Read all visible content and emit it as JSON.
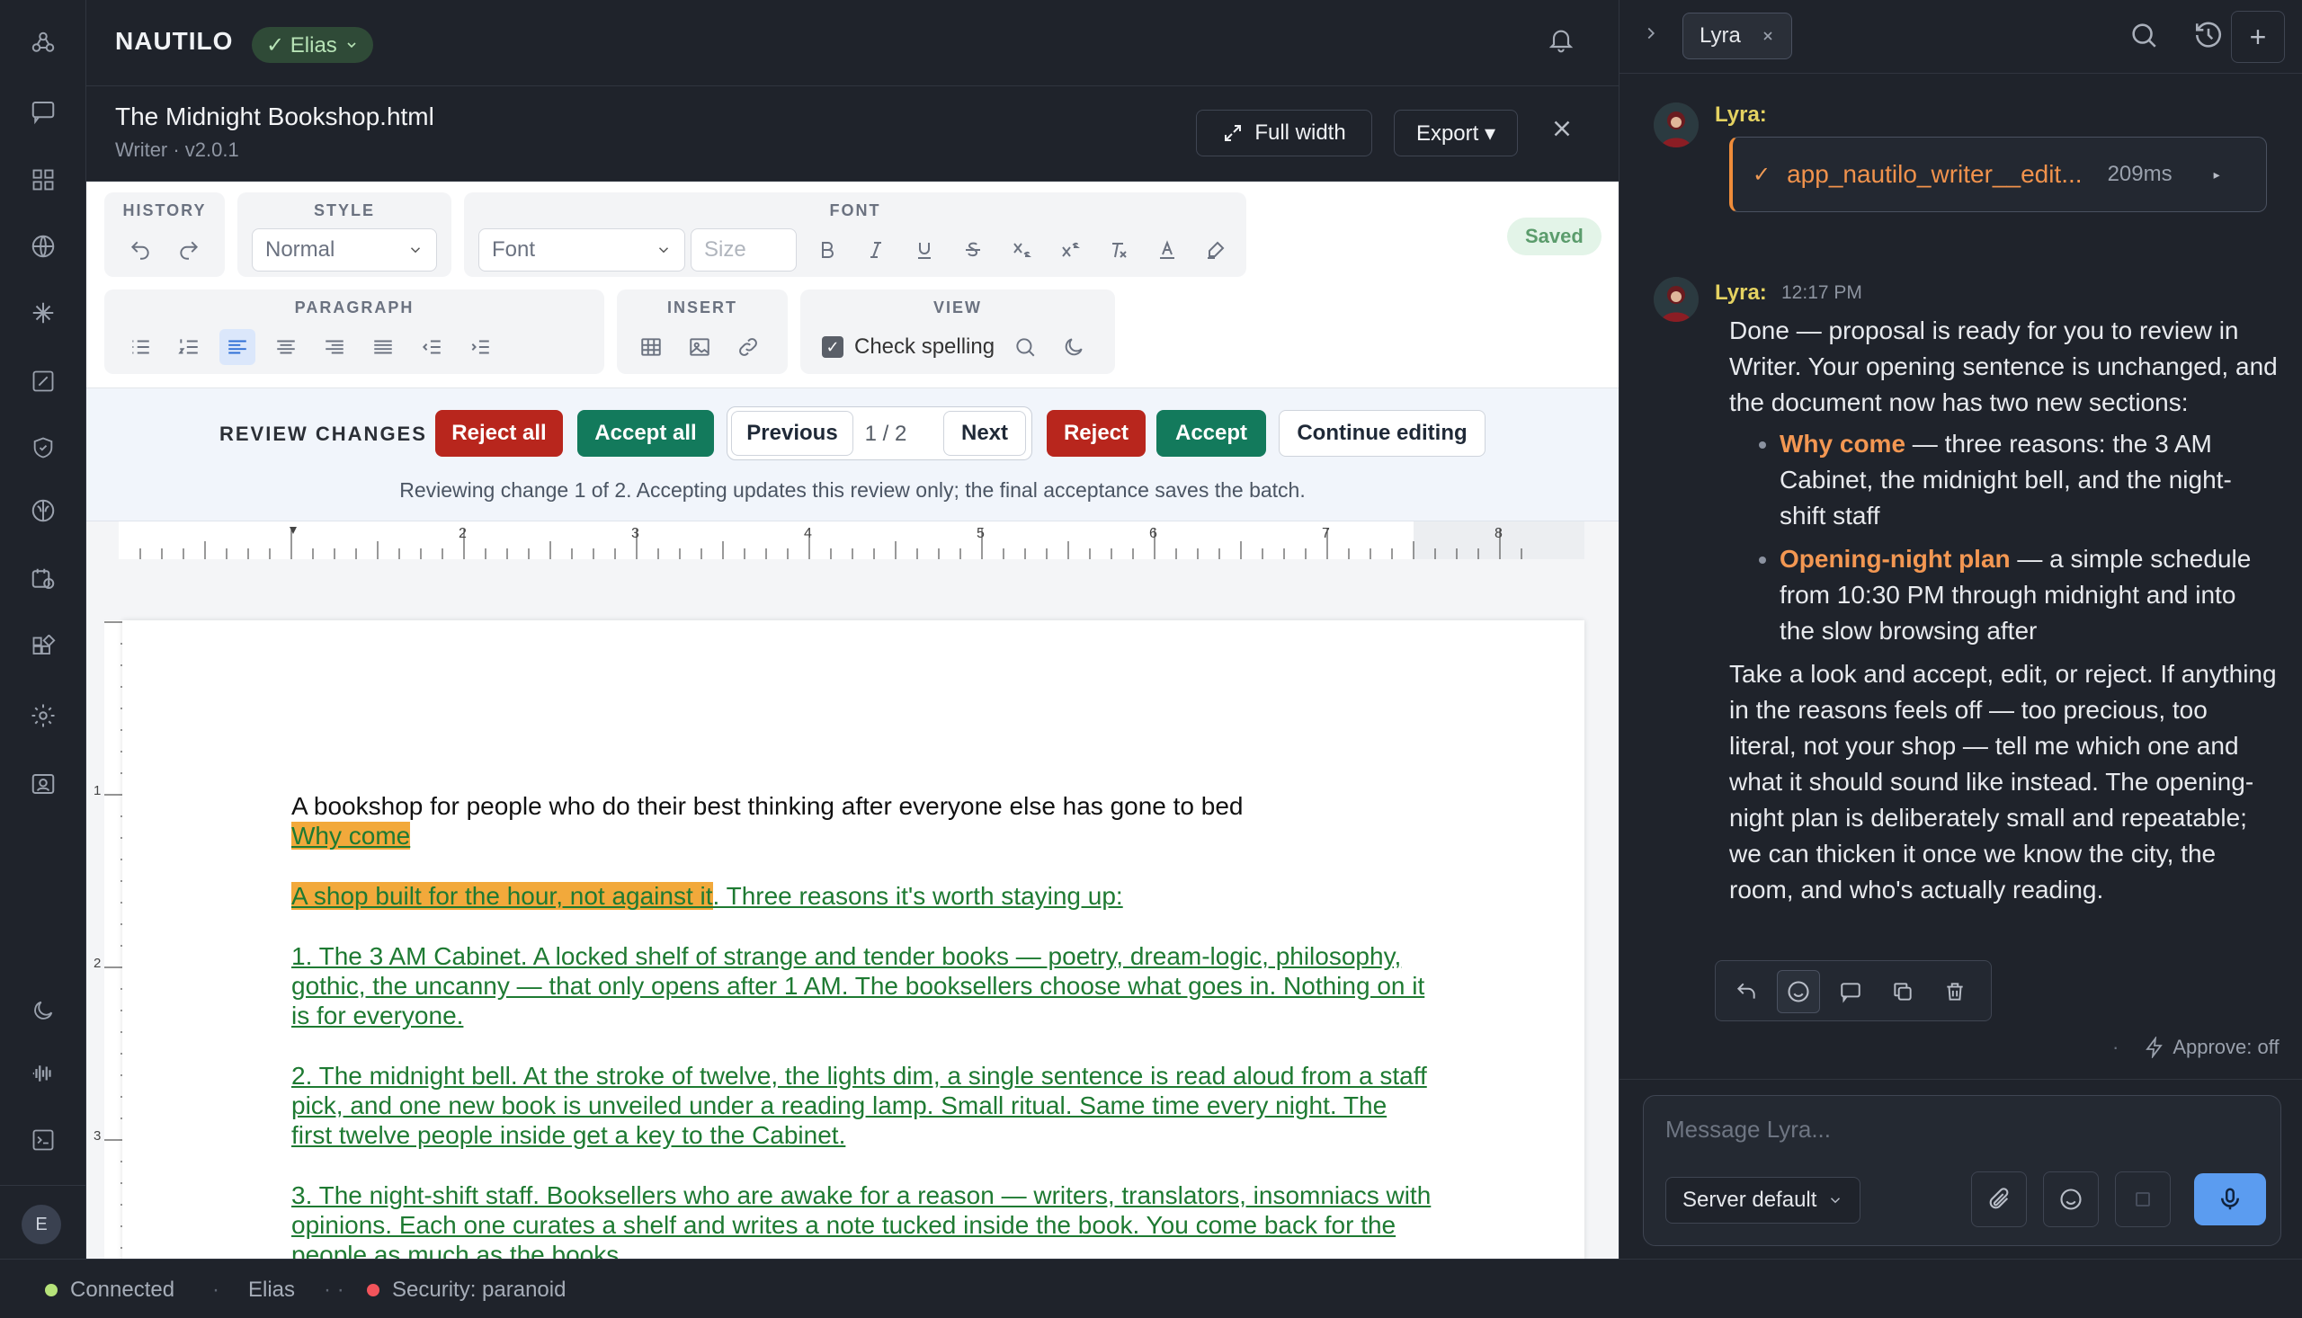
{
  "app": {
    "brand": "NAUTILO",
    "user_pill": "✓ Elias"
  },
  "document": {
    "title": "The Midnight Bookshop.html",
    "subtitle": "Writer · v2.0.1",
    "full_width_label": "Full width",
    "export_label": "Export ▾",
    "saved_label": "Saved"
  },
  "toolbar": {
    "history_label": "HISTORY",
    "style_label": "STYLE",
    "style_value": "Normal",
    "font_label": "FONT",
    "font_placeholder": "Font",
    "size_placeholder": "Size",
    "paragraph_label": "PARAGRAPH",
    "insert_label": "INSERT",
    "view_label": "VIEW",
    "check_spelling": "Check spelling"
  },
  "review": {
    "label": "REVIEW CHANGES",
    "reject_all": "Reject all",
    "accept_all": "Accept all",
    "previous": "Previous",
    "pager": "1 / 2",
    "next": "Next",
    "reject": "Reject",
    "accept": "Accept",
    "continue_editing": "Continue editing",
    "note": "Reviewing change 1 of 2. Accepting updates this review only; the final acceptance saves the batch."
  },
  "ruler": {
    "numbers": [
      "2",
      "3",
      "4",
      "5",
      "6",
      "7",
      "8"
    ],
    "vnumbers": [
      "1",
      "2",
      "3"
    ]
  },
  "page": {
    "lead": "A bookshop for people who do their best thinking after everyone else has gone to bed",
    "heading_inserted": "Why come",
    "intro_highlight": "A shop built for the hour, not against it",
    "intro_rest": ". Three reasons it's worth staying up:",
    "item1": "1. The 3 AM Cabinet. A locked shelf of strange and tender books — poetry, dream-logic, philosophy, gothic, the uncanny — that only opens after 1 AM. The booksellers choose what goes in. Nothing on it is for everyone.",
    "item2": "2. The midnight bell. At the stroke of twelve, the lights dim, a single sentence is read aloud from a staff pick, and one new book is unveiled under a reading lamp. Small ritual. Same time every night. The first twelve people inside get a key to the Cabinet.",
    "item3": "3. The night-shift staff. Booksellers who are awake for a reason — writers, translators, insomniacs with opinions. Each one curates a shelf and writes a note tucked inside the book. You come back for the people as much as the books."
  },
  "chat": {
    "tab_label": "Lyra",
    "speaker": "Lyra:",
    "tool_name": "app_nautilo_writer__edit...",
    "tool_duration": "209ms",
    "time": "12:17 PM",
    "intro": "Done — proposal is ready for you to review in Writer. Your opening sentence is unchanged, and the document now has two new sections:",
    "bullet1_bold": "Why come",
    "bullet1_rest": " — three reasons: the 3 AM Cabinet, the midnight bell, and the night-shift staff",
    "bullet2_bold": "Opening-night plan",
    "bullet2_rest": " — a simple schedule from 10:30 PM through midnight and into the slow browsing after",
    "outro": "Take a look and accept, edit, or reject. If anything in the reasons feels off — too precious, too literal, not your shop — tell me which one and what it should sound like instead. The opening-night plan is deliberately small and repeatable; we can thicken it once we know the city, the room, and who's actually reading.",
    "approve": "Approve: off",
    "composer_placeholder": "Message Lyra...",
    "model": "Server default"
  },
  "status": {
    "connected": "Connected",
    "user": "Elias",
    "security": "Security: paranoid"
  },
  "colors": {
    "accent_blue": "#5b9cf0",
    "reject_red": "#b8261d",
    "accept_green": "#137a5c",
    "insert_green": "#1e7a32",
    "highlight_orange": "#f2a93b",
    "speaker_yellow": "#e4d261",
    "connected_dot": "#b6e37a",
    "security_dot": "#f2545b"
  },
  "icons": {
    "rail": [
      "nodes-icon",
      "chat-icon",
      "grid-icon",
      "globe-icon",
      "sparkle-icon",
      "edit-square-icon",
      "shield-icon",
      "brain-icon",
      "calendar-clock-icon",
      "widgets-icon",
      "settings-icon",
      "screen-user-icon",
      "moon-icon",
      "waveform-icon",
      "terminal-icon"
    ]
  }
}
